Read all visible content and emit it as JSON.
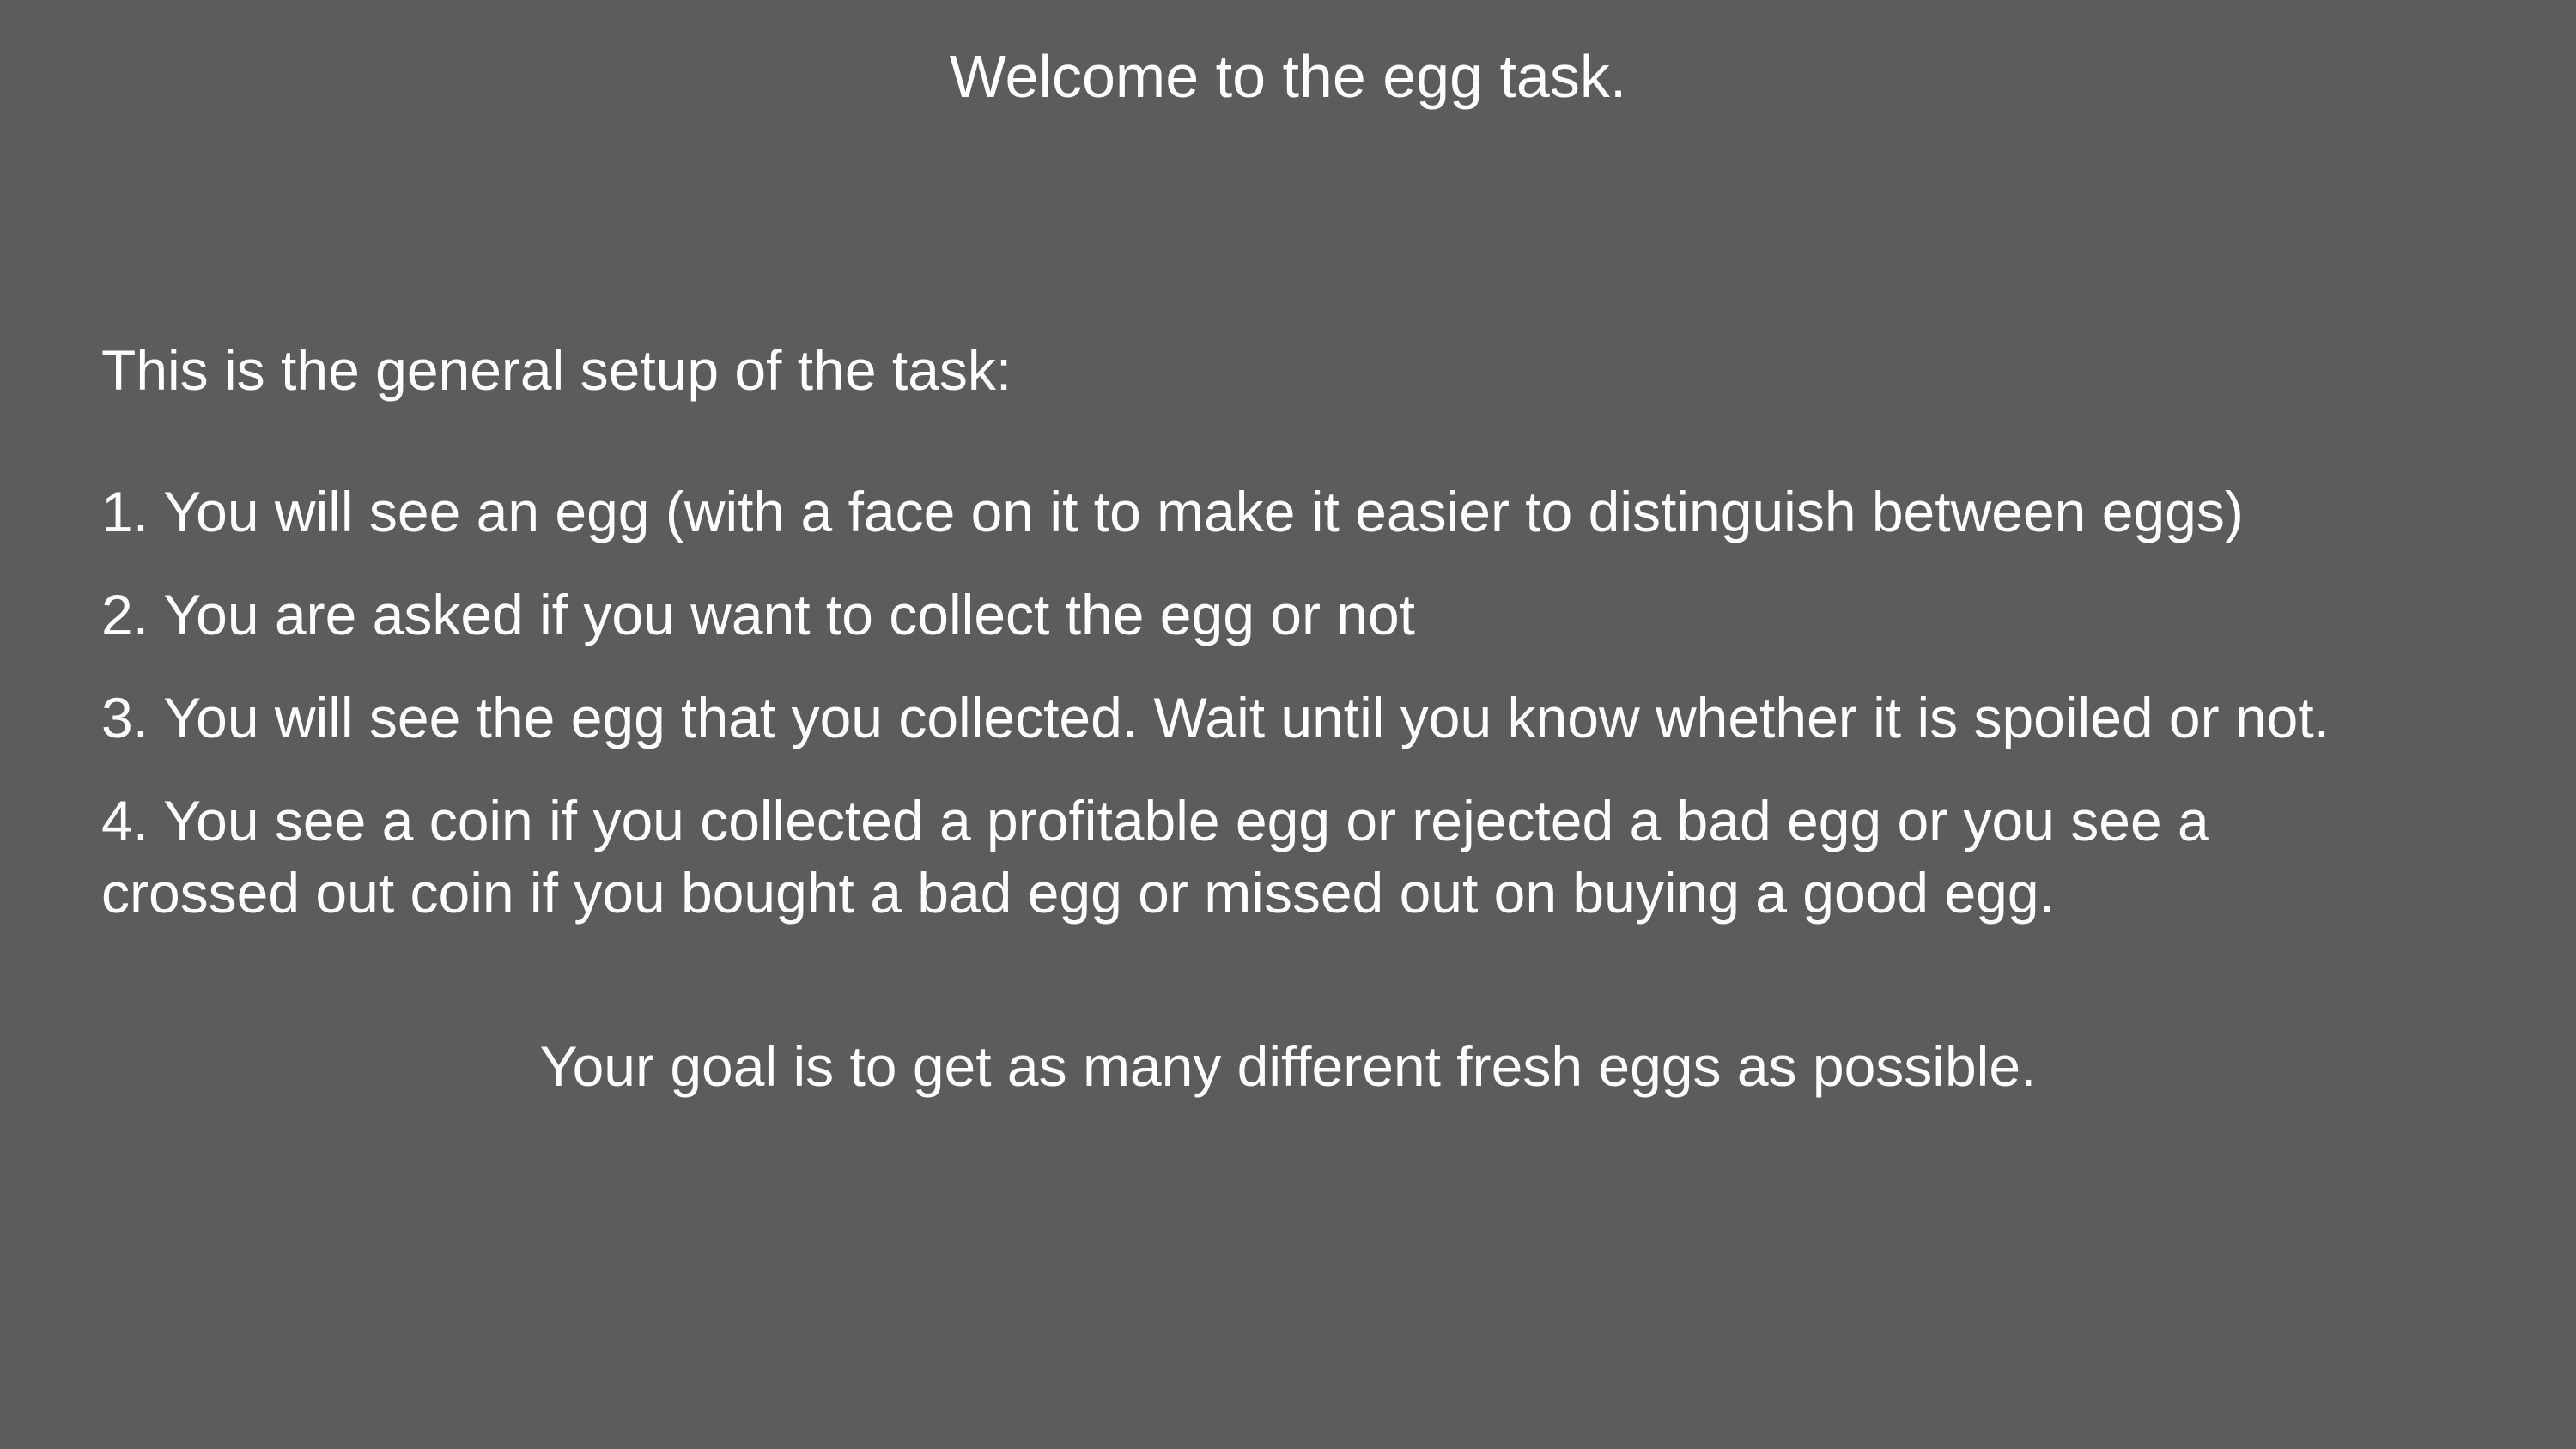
{
  "screen": {
    "background_color": "#5c5c5c",
    "text_color": "#ffffff"
  },
  "title": "Welcome to the egg task.",
  "intro": "This is the general setup of the task:",
  "steps": [
    "1. You will see an egg (with a face on it to make it easier to distinguish between eggs)",
    "2. You are asked if you want to collect the egg or not",
    "3. You will see the egg that you collected. Wait until you know whether it is spoiled or not.",
    "4. You see a coin if you collected a profitable egg or rejected a bad egg or you see a crossed out coin if you bought a bad egg or missed out on buying a good egg."
  ],
  "goal": "Your goal is to get as many different fresh eggs as possible."
}
